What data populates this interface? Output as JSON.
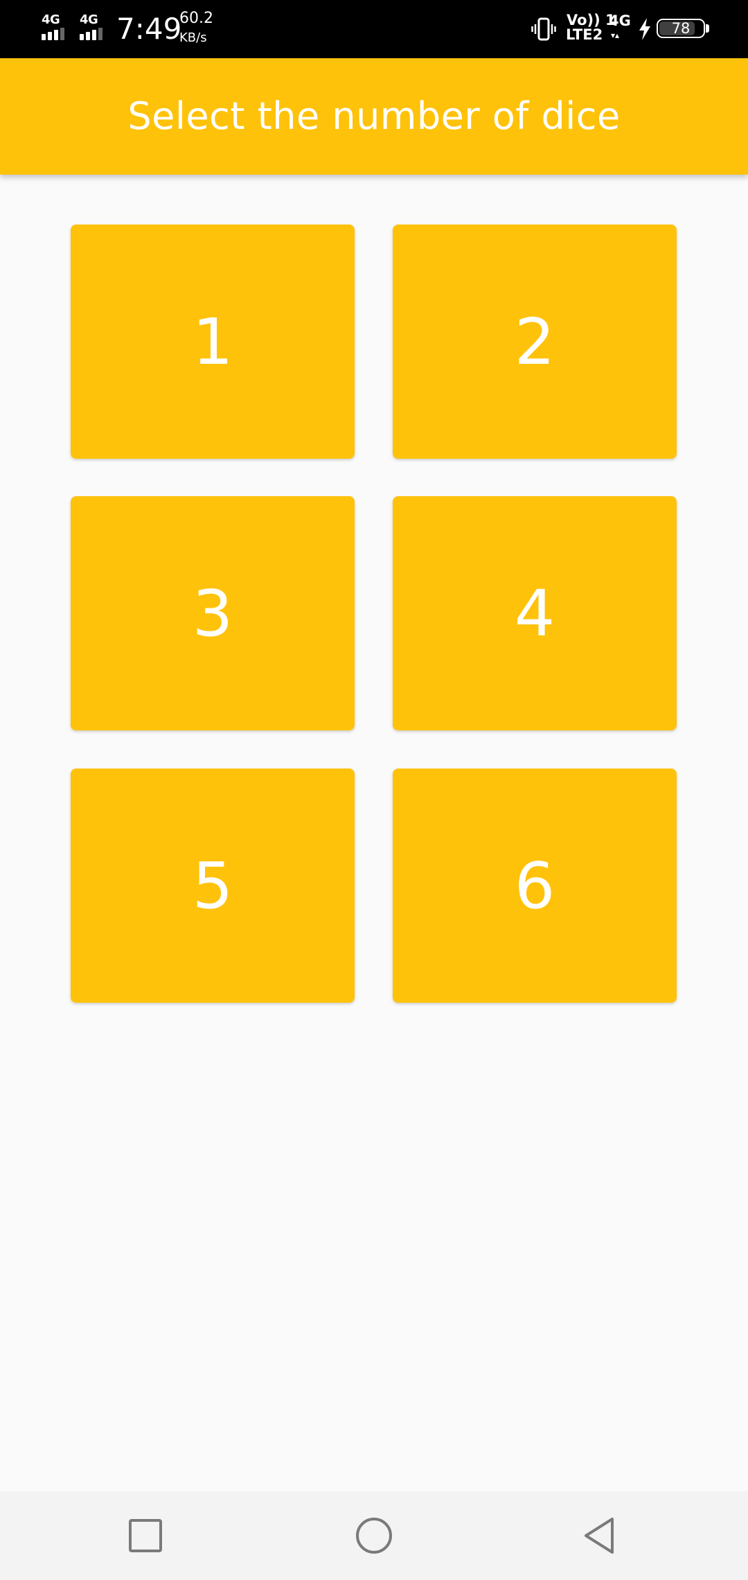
{
  "status_bar": {
    "sim1_label": "4G",
    "sim2_label": "4G",
    "time": "7:49",
    "speed_value": "60.2",
    "speed_unit": "KB/s",
    "volte_top": "Vo)) 1",
    "volte_bottom": "LTE2",
    "network": "4G",
    "network_arrows": "▾▴",
    "battery_level": "78",
    "icons": [
      "signal-icon",
      "signal-icon",
      "vibrate-icon",
      "charging-bolt-icon",
      "battery-icon"
    ]
  },
  "app_bar": {
    "title": "Select the number of dice",
    "color": "#FFC20A"
  },
  "dice_options": [
    "1",
    "2",
    "3",
    "4",
    "5",
    "6"
  ],
  "colors": {
    "accent": "#FFC20A",
    "background": "#FAFAFA",
    "text_on_accent": "#FFFFFF"
  },
  "nav_bar": {
    "icons": [
      "recents-square-icon",
      "home-circle-icon",
      "back-triangle-icon"
    ]
  }
}
